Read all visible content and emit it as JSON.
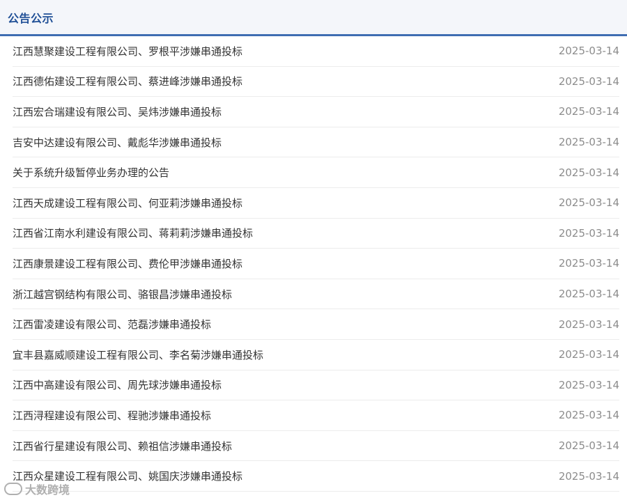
{
  "header": {
    "title": "公告公示"
  },
  "notices": [
    {
      "title": "江西慧聚建设工程有限公司、罗根平涉嫌串通投标",
      "date": "2025-03-14"
    },
    {
      "title": "江西德佑建设工程有限公司、蔡进峰涉嫌串通投标",
      "date": "2025-03-14"
    },
    {
      "title": "江西宏合瑞建设有限公司、吴炜涉嫌串通投标",
      "date": "2025-03-14"
    },
    {
      "title": "吉安中达建设有限公司、戴彪华涉嫌串通投标",
      "date": "2025-03-14"
    },
    {
      "title": "关于系统升级暂停业务办理的公告",
      "date": "2025-03-14"
    },
    {
      "title": "江西天成建设工程有限公司、何亚莉涉嫌串通投标",
      "date": "2025-03-14"
    },
    {
      "title": "江西省江南水利建设有限公司、蒋莉莉涉嫌串通投标",
      "date": "2025-03-14"
    },
    {
      "title": "江西康景建设工程有限公司、费伦甲涉嫌串通投标",
      "date": "2025-03-14"
    },
    {
      "title": "浙江越宫钢结构有限公司、骆银昌涉嫌串通投标",
      "date": "2025-03-14"
    },
    {
      "title": "江西雷凌建设有限公司、范磊涉嫌串通投标",
      "date": "2025-03-14"
    },
    {
      "title": "宜丰县嘉威顺建设工程有限公司、李名菊涉嫌串通投标",
      "date": "2025-03-14"
    },
    {
      "title": "江西中高建设有限公司、周先球涉嫌串通投标",
      "date": "2025-03-14"
    },
    {
      "title": "江西浔程建设有限公司、程驰涉嫌串通投标",
      "date": "2025-03-14"
    },
    {
      "title": "江西省行星建设有限公司、赖祖信涉嫌串通投标",
      "date": "2025-03-14"
    },
    {
      "title": "江西众星建设工程有限公司、姚国庆涉嫌串通投标",
      "date": "2025-03-14"
    }
  ],
  "watermark": {
    "text": "大数跨境"
  }
}
